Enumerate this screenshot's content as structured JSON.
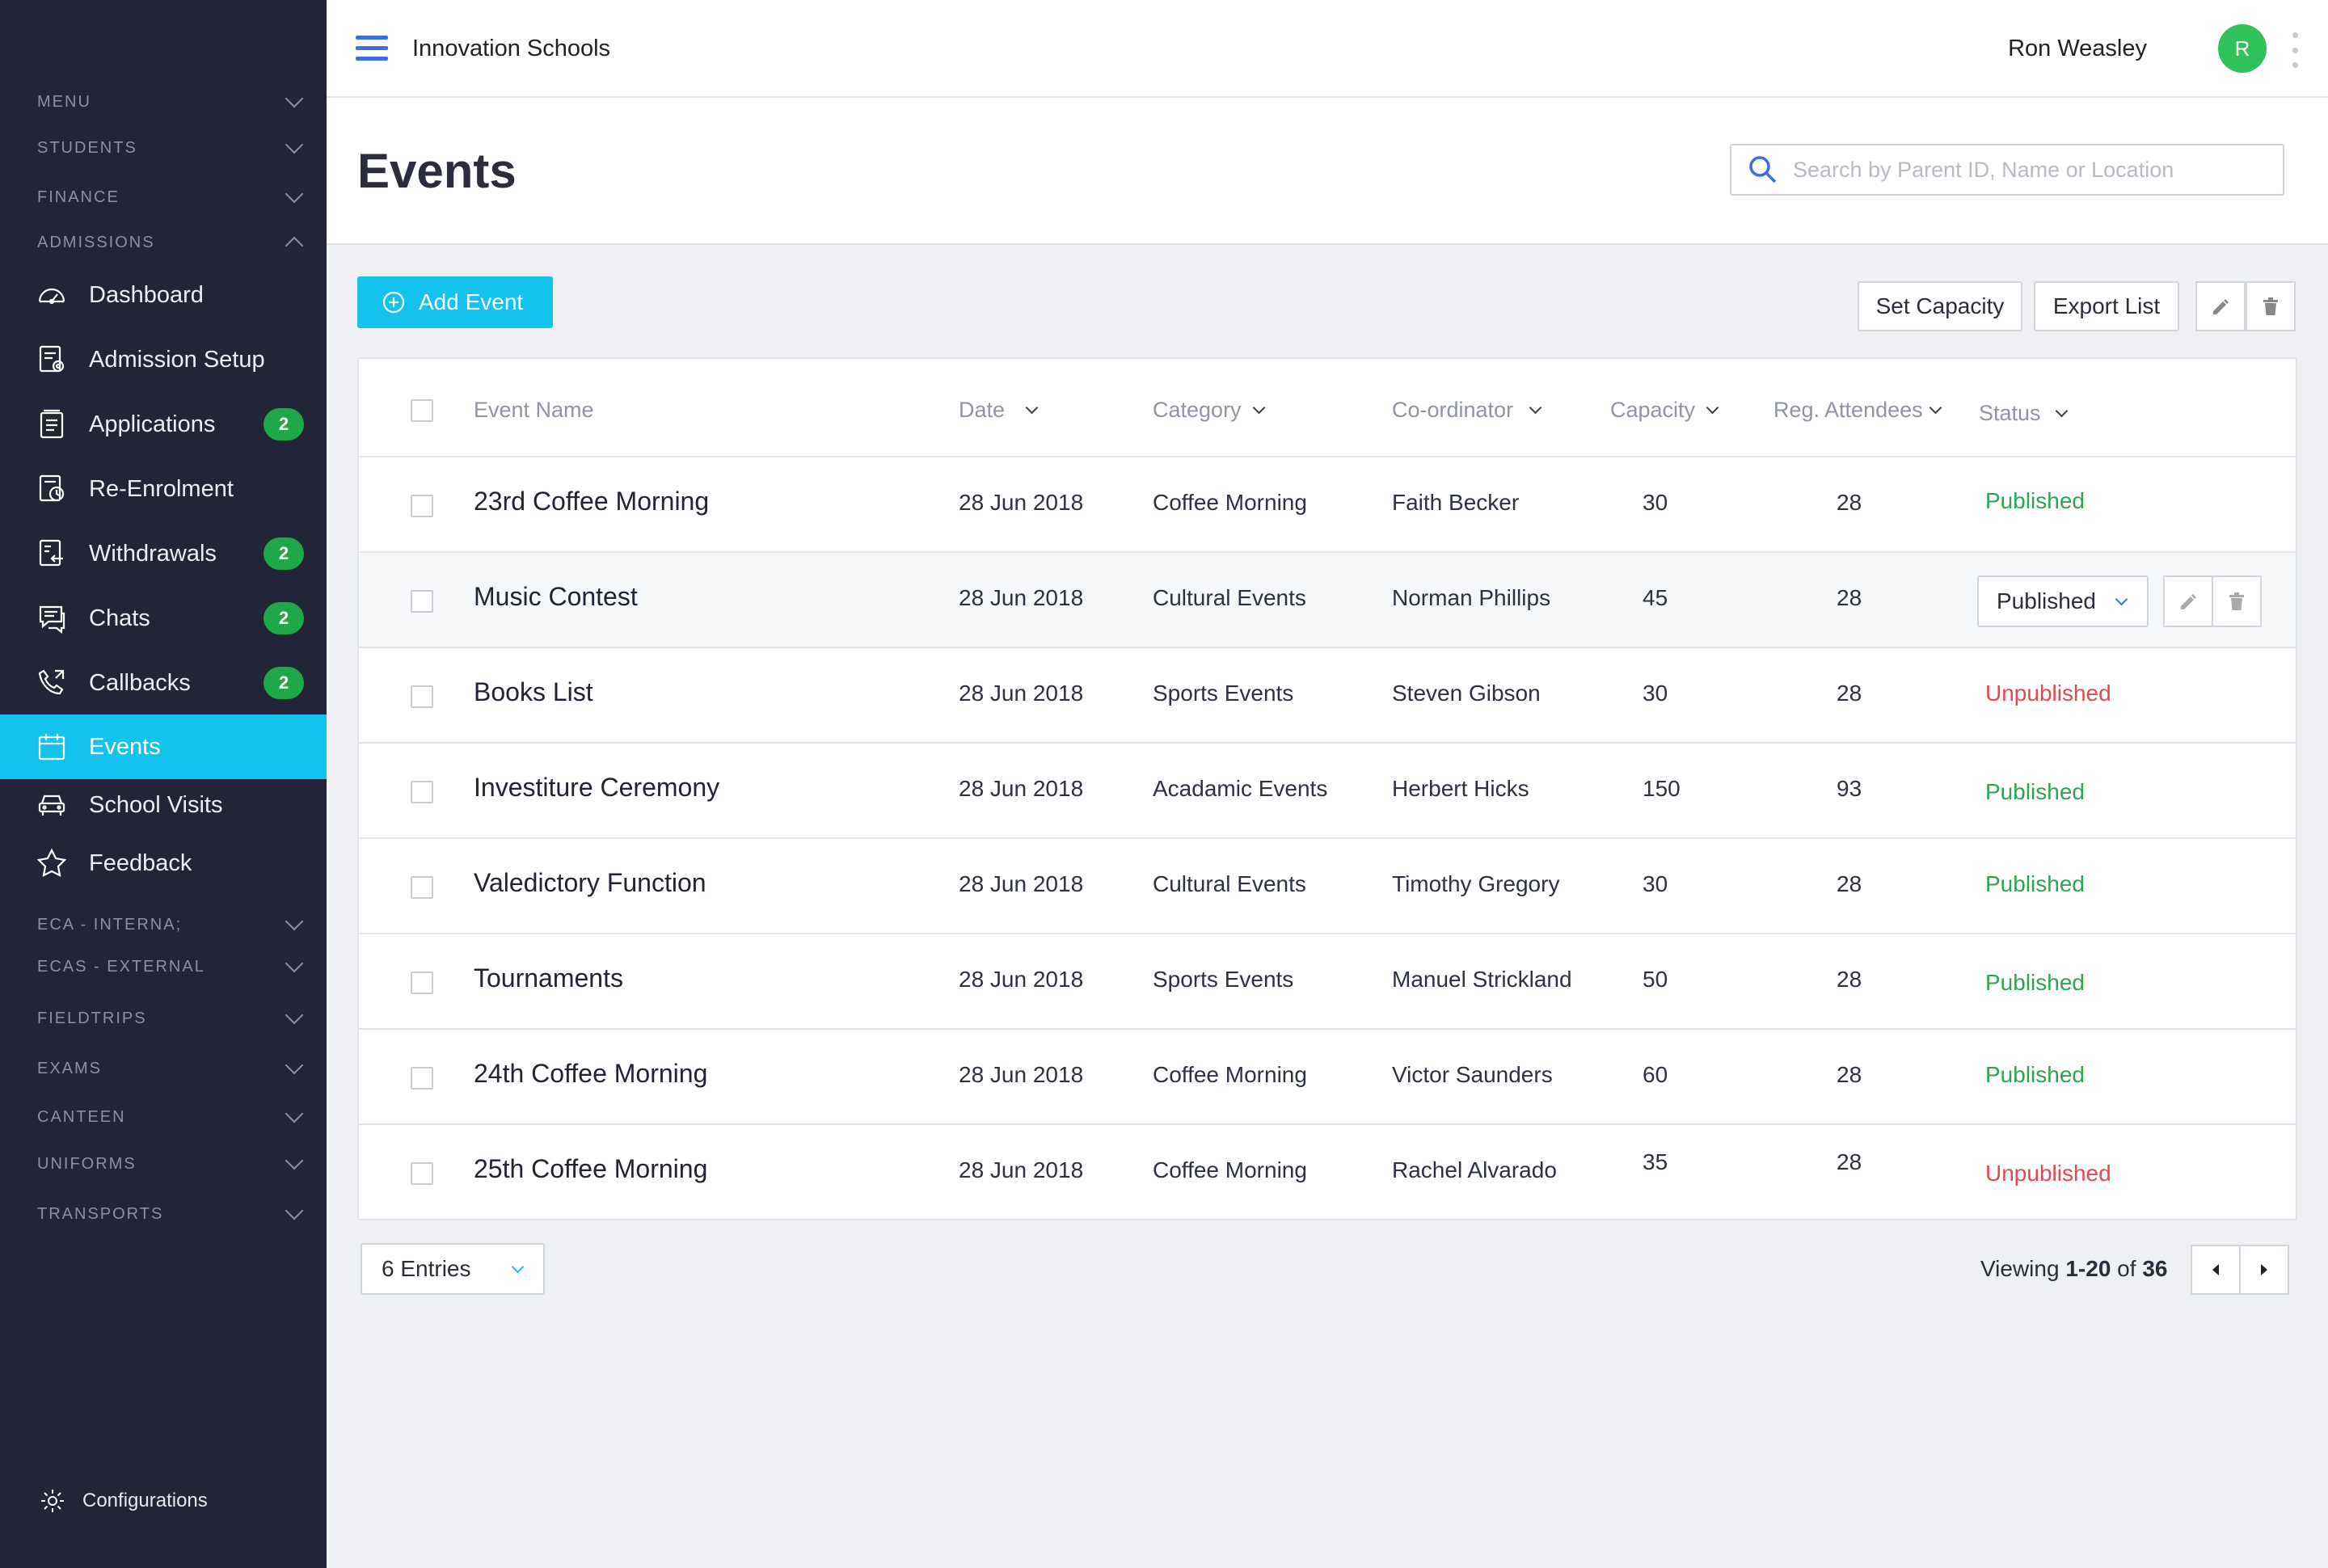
{
  "app": {
    "org_name": "Innovation Schools",
    "user_name": "Ron Weasley",
    "user_initial": "R"
  },
  "sidebar": {
    "sections_top": [
      {
        "label": "MENU"
      },
      {
        "label": "STUDENTS"
      },
      {
        "label": "FINANCE"
      },
      {
        "label": "ADMISSIONS"
      }
    ],
    "items": [
      {
        "label": "Dashboard",
        "icon": "dashboard-icon"
      },
      {
        "label": "Admission Setup",
        "icon": "admission-setup-icon"
      },
      {
        "label": "Applications",
        "icon": "applications-icon",
        "badge": "2"
      },
      {
        "label": "Re-Enrolment",
        "icon": "re-enrolment-icon"
      },
      {
        "label": "Withdrawals",
        "icon": "withdrawals-icon",
        "badge": "2"
      },
      {
        "label": "Chats",
        "icon": "chats-icon",
        "badge": "2"
      },
      {
        "label": "Callbacks",
        "icon": "callbacks-icon",
        "badge": "2"
      },
      {
        "label": "Events",
        "icon": "calendar-icon",
        "active": true
      },
      {
        "label": "School Visits",
        "icon": "car-icon"
      },
      {
        "label": "Feedback",
        "icon": "star-icon"
      }
    ],
    "sections_bottom": [
      {
        "label": "ECA - INTERNA;"
      },
      {
        "label": "ECAS - EXTERNAL"
      },
      {
        "label": "FIELDTRIPS"
      },
      {
        "label": "EXAMS"
      },
      {
        "label": "CANTEEN"
      },
      {
        "label": "UNIFORMS"
      },
      {
        "label": "TRANSPORTS"
      }
    ],
    "config_label": "Configurations"
  },
  "page": {
    "title": "Events",
    "search_placeholder": "Search by Parent ID, Name or Location"
  },
  "toolbar": {
    "add_label": "Add Event",
    "set_capacity_label": "Set Capacity",
    "export_label": "Export List"
  },
  "table": {
    "columns": {
      "name": "Event Name",
      "date": "Date",
      "category": "Category",
      "coordinator": "Co-ordinator",
      "capacity": "Capacity",
      "attendees": "Reg. Attendees",
      "status": "Status"
    },
    "rows": [
      {
        "name": "23rd Coffee Morning",
        "date": "28 Jun 2018",
        "category": "Coffee Morning",
        "coordinator": "Faith Becker",
        "capacity": "30",
        "attendees": "28",
        "status": "Published"
      },
      {
        "name": "Music Contest",
        "date": "28 Jun 2018",
        "category": "Cultural Events",
        "coordinator": "Norman Phillips",
        "capacity": "45",
        "attendees": "28",
        "status": "Published",
        "editing": true
      },
      {
        "name": "Books List",
        "date": "28 Jun 2018",
        "category": "Sports Events",
        "coordinator": "Steven Gibson",
        "capacity": "30",
        "attendees": "28",
        "status": "Unpublished"
      },
      {
        "name": "Investiture Ceremony",
        "date": "28 Jun 2018",
        "category": "Acadamic Events",
        "coordinator": "Herbert Hicks",
        "capacity": "150",
        "attendees": "93",
        "status": "Published"
      },
      {
        "name": "Valedictory Function",
        "date": "28 Jun 2018",
        "category": "Cultural Events",
        "coordinator": "Timothy Gregory",
        "capacity": "30",
        "attendees": "28",
        "status": "Published"
      },
      {
        "name": "Tournaments",
        "date": "28 Jun 2018",
        "category": "Sports Events",
        "coordinator": "Manuel Strickland",
        "capacity": "50",
        "attendees": "28",
        "status": "Published"
      },
      {
        "name": "24th Coffee Morning",
        "date": "28 Jun 2018",
        "category": "Coffee Morning",
        "coordinator": "Victor Saunders",
        "capacity": "60",
        "attendees": "28",
        "status": "Published"
      },
      {
        "name": "25th Coffee Morning",
        "date": "28 Jun 2018",
        "category": "Coffee Morning",
        "coordinator": "Rachel Alvarado",
        "capacity": "35",
        "attendees": "28",
        "status": "Unpublished"
      }
    ]
  },
  "footer": {
    "entries_label": "6 Entries",
    "viewing_prefix": "Viewing",
    "viewing_range": "1-20",
    "viewing_of": "of",
    "viewing_total": "36"
  },
  "colors": {
    "accent": "#13c3ee",
    "sidebar_bg": "#222437",
    "published": "#2ea44f",
    "unpublished": "#e5484d",
    "badge": "#1fa84a"
  }
}
